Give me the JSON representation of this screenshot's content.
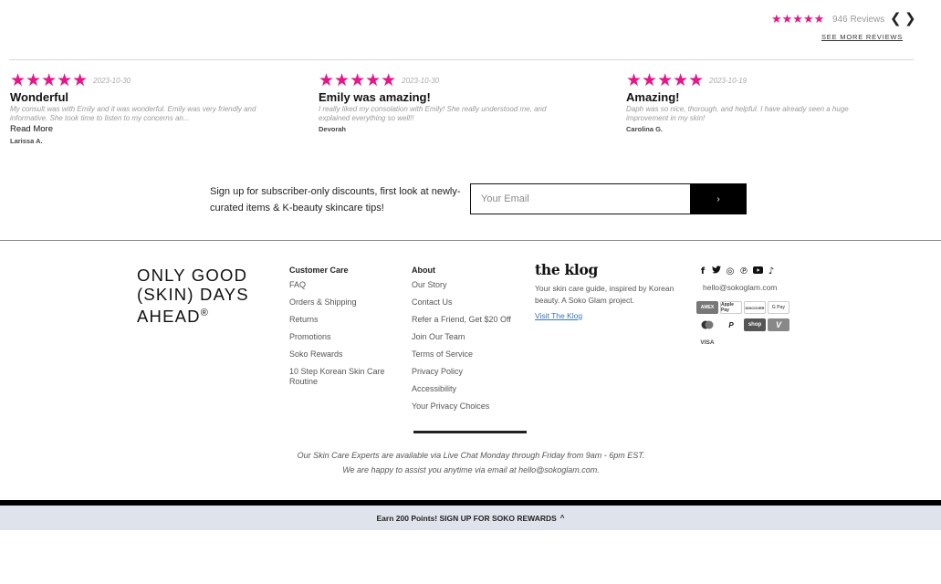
{
  "summary": {
    "stars": "★★★★★",
    "count": "946 Reviews",
    "prev": "❮",
    "next": "❯",
    "see_more": "SEE MORE REVIEWS"
  },
  "reviews": [
    {
      "stars": "★★★★★",
      "date": "2023-10-30",
      "title": "Wonderful",
      "body": "My consult was with Emily and it was wonderful. Emily was very friendly and informative. She took time to listen to my concerns an...",
      "read_more": "Read More",
      "author": "Larissa A."
    },
    {
      "stars": "★★★★★",
      "date": "2023-10-30",
      "title": "Emily was amazing!",
      "body": "I really liked my consolation with Emily! She really understood me, and explained everything so well!!",
      "author": "Devorah"
    },
    {
      "stars": "★★★★★",
      "date": "2023-10-19",
      "title": "Amazing!",
      "body": "Daph was so nice, thorough, and helpful. I have already seen a huge improvement in my skin!",
      "author": "Carolina G."
    }
  ],
  "signup": {
    "text": "Sign up for subscriber-only discounts, first look at newly-curated items & K-beauty skincare tips!",
    "placeholder": "Your Email",
    "submit": "›"
  },
  "brand": {
    "line": "ONLY GOOD (SKIN) DAYS AHEAD",
    "mark": "®"
  },
  "customer_care": {
    "heading": "Customer Care",
    "links": [
      "FAQ",
      "Orders & Shipping",
      "Returns",
      "Promotions",
      "Soko Rewards",
      "10 Step Korean Skin Care Routine"
    ]
  },
  "about": {
    "heading": "About",
    "links": [
      "Our Story",
      "Contact Us",
      "Refer a Friend, Get $20 Off",
      "Join Our Team",
      "Terms of Service",
      "Privacy Policy",
      "Accessibility",
      "Your Privacy Choices"
    ]
  },
  "klog": {
    "logo": "the klog",
    "description": "Your skin care guide, inspired by Korean beauty. A Soko Glam project.",
    "link": "Visit The Klog"
  },
  "social": {
    "icons": [
      "facebook-icon",
      "twitter-icon",
      "instagram-icon",
      "pinterest-icon",
      "youtube-icon",
      "tiktok-icon"
    ],
    "glyphs": [
      "f",
      "🐦",
      "◎",
      "℗",
      "▶",
      "♪"
    ],
    "email": "hello@sokoglam.com"
  },
  "payments": [
    "AMEX",
    "Apple Pay",
    "DISCOVER",
    "G Pay",
    "●●",
    "P",
    "shop",
    "V",
    "VISA"
  ],
  "expert_text": {
    "line1": "Our Skin Care Experts are available via Live Chat Monday through Friday from 9am - 6pm EST.",
    "line2": "We are happy to assist you anytime via email at hello@sokoglam.com."
  },
  "rewards_bar": {
    "text": "Earn 200 Points! SIGN UP FOR SOKO REWARDS",
    "chevron": "^"
  },
  "colors": {
    "star_pink": "#e7158b",
    "rewards_bg": "#dfe4ec",
    "link_blue": "#3a75b5"
  }
}
